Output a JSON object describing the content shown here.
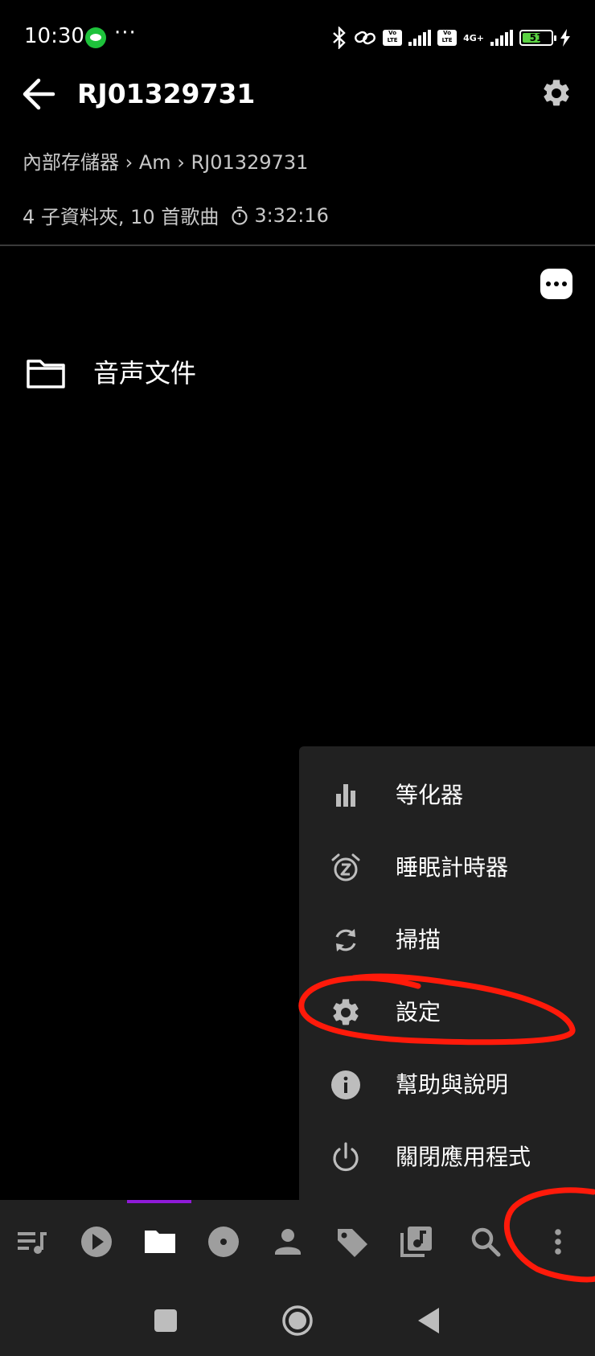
{
  "status_bar": {
    "time": "10:30",
    "overflow_dots": "···",
    "network": "4G+",
    "battery": "51",
    "volte_label": "Vo LTE"
  },
  "toolbar": {
    "title": "RJ01329731"
  },
  "breadcrumb": "內部存儲器 › Am › RJ01329731",
  "folder_info": {
    "summary": "4 子資料夾, 10 首歌曲",
    "duration": "3:32:16"
  },
  "folders": [
    {
      "name": "音声文件",
      "icon": "folder-icon"
    }
  ],
  "menu": {
    "items": [
      {
        "label": "等化器",
        "icon": "equalizer-icon"
      },
      {
        "label": "睡眠計時器",
        "icon": "alarm-snooze-icon"
      },
      {
        "label": "掃描",
        "icon": "refresh-icon"
      },
      {
        "label": "設定",
        "icon": "gear-icon"
      },
      {
        "label": "幫助與說明",
        "icon": "info-icon"
      },
      {
        "label": "關閉應用程式",
        "icon": "power-icon"
      }
    ]
  },
  "bottom_nav": {
    "items": [
      {
        "icon": "queue-music-icon",
        "active": false
      },
      {
        "icon": "play-circle-icon",
        "active": false
      },
      {
        "icon": "folder-icon",
        "active": true
      },
      {
        "icon": "album-icon",
        "active": false
      },
      {
        "icon": "person-icon",
        "active": false
      },
      {
        "icon": "tag-icon",
        "active": false
      },
      {
        "icon": "library-music-icon",
        "active": false
      },
      {
        "icon": "search-icon",
        "active": false
      },
      {
        "icon": "more-vert-icon",
        "active": false
      }
    ]
  },
  "system_nav": [
    "recents-icon",
    "home-icon",
    "back-icon"
  ],
  "colors": {
    "background": "#000000",
    "menu_background": "#212121",
    "accent": "#8f1ad8",
    "annotation": "#ff1a0a"
  }
}
